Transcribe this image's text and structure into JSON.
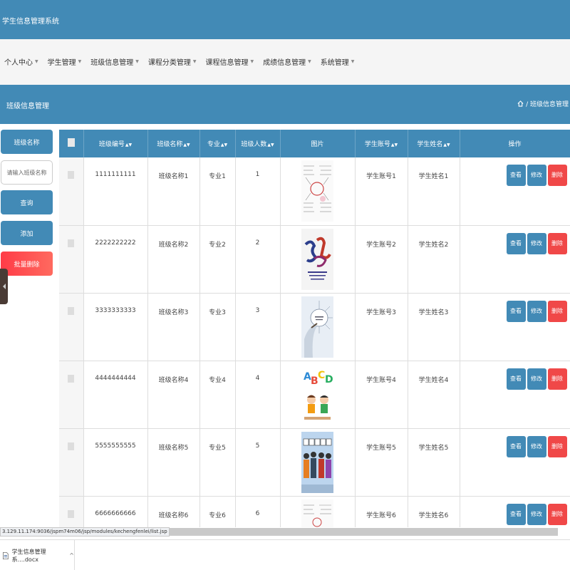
{
  "app": {
    "title": "学生信息管理系统"
  },
  "nav": {
    "items": [
      {
        "label": "个人中心"
      },
      {
        "label": "学生管理"
      },
      {
        "label": "班级信息管理"
      },
      {
        "label": "课程分类管理"
      },
      {
        "label": "课程信息管理"
      },
      {
        "label": "成绩信息管理"
      },
      {
        "label": "系统管理"
      }
    ]
  },
  "page": {
    "title": "班级信息管理",
    "breadcrumb": "/ 班级信息管理"
  },
  "search": {
    "label": "班级名称",
    "placeholder": "请输入班级名称",
    "query_label": "查询",
    "add_label": "添加",
    "batch_delete_label": "批量删除"
  },
  "table": {
    "columns": [
      "班级编号",
      "班级名称",
      "专业",
      "班级人数",
      "图片",
      "学生账号",
      "学生姓名",
      "操作"
    ],
    "rows": [
      {
        "code": "1111111111",
        "name": "班级名称1",
        "major": "专业1",
        "count": "1",
        "account": "学生账号1",
        "student": "学生姓名1"
      },
      {
        "code": "2222222222",
        "name": "班级名称2",
        "major": "专业2",
        "count": "2",
        "account": "学生账号2",
        "student": "学生姓名2"
      },
      {
        "code": "3333333333",
        "name": "班级名称3",
        "major": "专业3",
        "count": "3",
        "account": "学生账号3",
        "student": "学生姓名3"
      },
      {
        "code": "4444444444",
        "name": "班级名称4",
        "major": "专业4",
        "count": "4",
        "account": "学生账号4",
        "student": "学生姓名4"
      },
      {
        "code": "5555555555",
        "name": "班级名称5",
        "major": "专业5",
        "count": "5",
        "account": "学生账号5",
        "student": "学生姓名5"
      },
      {
        "code": "6666666666",
        "name": "班级名称6",
        "major": "专业6",
        "count": "6",
        "account": "学生账号6",
        "student": "学生姓名6"
      }
    ],
    "actions": {
      "view": "查看",
      "edit": "修改",
      "delete": "删除"
    }
  },
  "status": {
    "url": "3.129.11.174:9036/jspm74m06/jsp/modules/kechengfenlei/list.jsp"
  },
  "download": {
    "filename": "学生信息管理系....docx"
  },
  "colors": {
    "primary": "#428ab6",
    "danger": "#f04848"
  }
}
